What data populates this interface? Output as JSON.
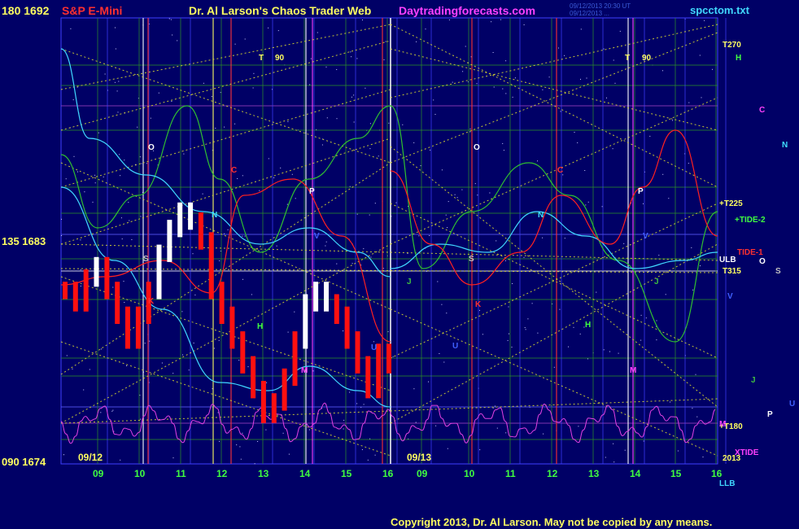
{
  "header": {
    "left_scale_top": "180  1692",
    "instrument": "S&P E-Mini",
    "title": "Dr. Al Larson's Chaos Trader Web",
    "site": "Daytradingforecasts.com",
    "stamp_line1": "09/12/2013 20:30 UT",
    "stamp_line2": "09/12/2013 ...",
    "file": "spcctom.txt"
  },
  "footer": {
    "copyright": "Copyright 2013, Dr. Al Larson. May not be copied by any means."
  },
  "colors": {
    "background": "#000066",
    "grid_green": "#2a8a2a",
    "grid_blue": "#4040ff",
    "diag_yellow": "#d8d830",
    "price_red": "#ff1010",
    "price_white": "#ffffff",
    "cyan": "#40d8ff",
    "magenta": "#e040e0"
  },
  "chart_data": {
    "type": "line",
    "title": "S&P E-Mini",
    "xlabel": "",
    "ylabel": "",
    "y_axis_labels": [
      {
        "angle": "180",
        "price": "1692"
      },
      {
        "angle": "135",
        "price": "1683"
      },
      {
        "angle": "090",
        "price": "1674"
      }
    ],
    "ylim": [
      1674,
      1692
    ],
    "day_labels": [
      "09/12",
      "09/13"
    ],
    "x_ticks": [
      "09",
      "10",
      "11",
      "12",
      "13",
      "14",
      "15",
      "16",
      "09",
      "10",
      "11",
      "12",
      "13",
      "14",
      "15",
      "16"
    ],
    "series": [
      {
        "name": "",
        "values": [
          1681,
          1680.5,
          1681.5,
          1682,
          1681,
          1680,
          1679,
          1680,
          1681,
          1682.5,
          1683.5,
          1684.2,
          1683.8,
          1683,
          1681,
          1680,
          1679,
          1678,
          1677,
          1676,
          1676.5,
          1677.5,
          1679,
          1680.5,
          1681,
          1680.5,
          1680,
          1679,
          1678,
          1677,
          1678.5,
          1678
        ]
      }
    ],
    "right_labels": [
      {
        "text": "T270",
        "color": "#ffff60"
      },
      {
        "text": "H",
        "color": "#40ff40"
      },
      {
        "text": "C",
        "color": "#ff40ff"
      },
      {
        "text": "N",
        "color": "#40e0ff"
      },
      {
        "text": "+T225",
        "color": "#ffff60"
      },
      {
        "text": "+TIDE-2",
        "color": "#40ff40"
      },
      {
        "text": "TIDE-1",
        "color": "#ff3030"
      },
      {
        "text": "ULB",
        "color": "#ffffff"
      },
      {
        "text": "T315",
        "color": "#ffff60"
      },
      {
        "text": "O",
        "color": "#ffffff"
      },
      {
        "text": "S",
        "color": "#c0c0c0"
      },
      {
        "text": "V",
        "color": "#4060ff"
      },
      {
        "text": "J",
        "color": "#40c040"
      },
      {
        "text": "U",
        "color": "#4060ff"
      },
      {
        "text": "P",
        "color": "#ffffff"
      },
      {
        "text": "+T180",
        "color": "#ffff60"
      },
      {
        "text": "M",
        "color": "#ff40ff"
      },
      {
        "text": "XTIDE",
        "color": "#ff40ff"
      },
      {
        "text": "2013",
        "color": "#ffff60"
      },
      {
        "text": "LLB",
        "color": "#40d8ff"
      }
    ],
    "markers": [
      {
        "text": "T",
        "color": "#ffff60"
      },
      {
        "text": "90",
        "color": "#ffff60"
      },
      {
        "text": "O",
        "color": "#ffffff"
      },
      {
        "text": "C",
        "color": "#ff3030"
      },
      {
        "text": "N",
        "color": "#40e0ff"
      },
      {
        "text": "P",
        "color": "#ffffff"
      },
      {
        "text": "V",
        "color": "#4060ff"
      },
      {
        "text": "H",
        "color": "#40ff40"
      },
      {
        "text": "M",
        "color": "#ff40ff"
      },
      {
        "text": "K",
        "color": "#ff3030"
      },
      {
        "text": "J",
        "color": "#40c040"
      },
      {
        "text": "S",
        "color": "#c0c0c0"
      },
      {
        "text": "U",
        "color": "#4060ff"
      }
    ]
  }
}
